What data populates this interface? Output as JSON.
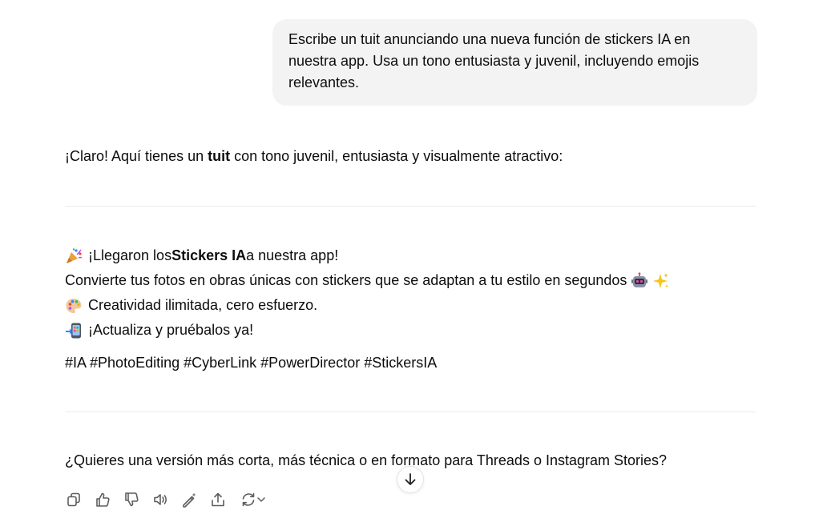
{
  "user_message": "Escribe un tuit anunciando una nueva función de stickers IA en nuestra app. Usa un tono entusiasta y juvenil, incluyendo emojis relevantes.",
  "assistant": {
    "intro_before": "¡Claro! Aquí tienes un ",
    "intro_bold": "tuit",
    "intro_after": " con tono juvenil, entusiasta y visualmente atractivo:",
    "tweet": {
      "line1_before": "¡Llegaron los ",
      "line1_bold": "Stickers IA",
      "line1_after": " a nuestra app!",
      "line2": "Convierte tus fotos en obras únicas con stickers que se adaptan a tu estilo en segundos",
      "line3": "Creatividad ilimitada, cero esfuerzo.",
      "line4": "¡Actualiza y pruébalos ya!",
      "hashtags": "#IA #PhotoEditing #CyberLink #PowerDirector #StickersIA"
    },
    "followup": "¿Quieres una versión más corta, más técnica o en formato para Threads o Instagram Stories?"
  },
  "icons": {
    "party": "party-popper-icon",
    "robot": "robot-icon",
    "sparkles": "sparkles-icon",
    "palette": "artist-palette-icon",
    "phone": "mobile-phone-arrow-icon",
    "scroll": "arrow-down-icon",
    "actions": [
      "copy-icon",
      "thumbs-up-icon",
      "thumbs-down-icon",
      "read-aloud-icon",
      "edit-magic-icon",
      "share-icon",
      "regenerate-icon",
      "chevron-down-icon"
    ]
  },
  "colors": {
    "bubble_bg": "#f3f3f3",
    "text": "#0d0d0d",
    "icon_gray": "#5d5d5d",
    "divider": "#ececec"
  }
}
